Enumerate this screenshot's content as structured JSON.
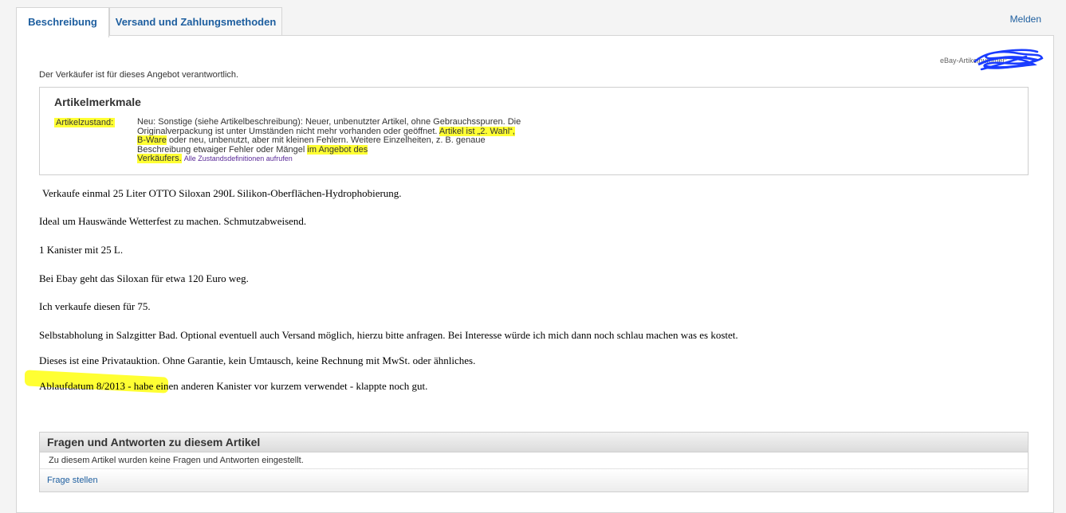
{
  "tabs": [
    {
      "label": "Beschreibung",
      "active": true
    },
    {
      "label": "Versand und Zahlungsmethoden",
      "active": false
    }
  ],
  "report_link": "Melden",
  "item_number_label": "eBay-Artikelnummer:",
  "seller_note": "Der Verkäufer ist für dieses Angebot verantwortlich.",
  "features": {
    "title": "Artikelmerkmale",
    "condition_label": "Artikelzustand:",
    "condition_line1": "Neu: Sonstige (siehe Artikelbeschreibung): Neuer, unbenutzter Artikel, ohne Gebrauchsspuren. Die",
    "condition_line2a": "Originalverpackung ist unter Umständen nicht mehr vorhanden oder geöffnet.",
    "condition_line2b": "Artikel ist „2. Wahl“,",
    "condition_line3a": "B-Ware",
    "condition_line3b": "oder neu, unbenutzt, aber mit kleinen Fehlern. Weitere Einzelheiten, z. B. genaue",
    "condition_line4a": "Beschreibung etwaiger Fehler oder Mängel",
    "condition_line4b": "im Angebot des",
    "condition_line5": "Verkäufers.",
    "condition_link": "Alle Zustandsdefinitionen aufrufen"
  },
  "description": [
    "Verkaufe einmal 25 Liter OTTO Siloxan 290L Silikon-Oberflächen-Hydrophobierung.",
    "Ideal um Hauswände Wetterfest zu machen. Schmutzabweisend.",
    "1 Kanister mit 25 L.",
    "Bei Ebay geht das Siloxan für etwa 120 Euro weg.",
    "Ich verkaufe diesen für 75.",
    "Selbstabholung in Salzgitter Bad. Optional eventuell auch Versand möglich, hierzu bitte anfragen. Bei Interesse würde ich mich dann noch schlau machen was es kostet.",
    "Dieses ist eine Privatauktion. Ohne Garantie, kein Umtausch, keine Rechnung mit MwSt. oder ähnliches."
  ],
  "expiry": {
    "highlighted": "Ablaufdatum 8/2013",
    "rest": " - habe einen anderen Kanister vor kurzem verwendet - klappte noch gut."
  },
  "qa": {
    "title": "Fragen und Antworten zu diesem Artikel",
    "empty_text": "Zu diesem Artikel wurden keine Fragen und Antworten eingestellt.",
    "ask_link": "Frage stellen"
  },
  "colors": {
    "link": "#1d5e9f",
    "highlight": "#ffff33",
    "scribble": "#1a3cff"
  }
}
